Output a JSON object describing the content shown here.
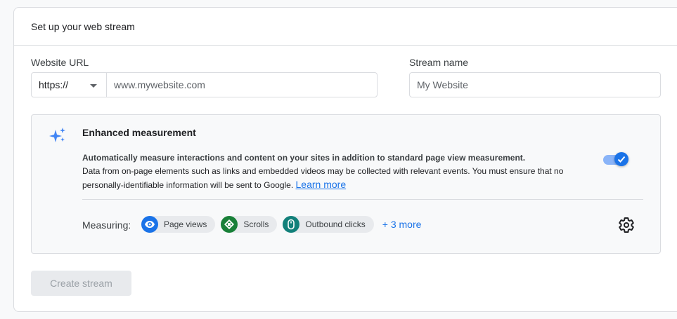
{
  "header": {
    "title": "Set up your web stream"
  },
  "website_url": {
    "label": "Website URL",
    "protocol": "https://",
    "placeholder": "www.mywebsite.com"
  },
  "stream_name": {
    "label": "Stream name",
    "placeholder": "My Website"
  },
  "enhanced": {
    "title": "Enhanced measurement",
    "desc_primary": "Automatically measure interactions and content on your sites in addition to standard page view measurement.",
    "desc_secondary": "Data from on-page elements such as links and embedded videos may be collected with relevant events. You must ensure that no personally-identifiable information will be sent to Google.",
    "learn_more": "Learn more",
    "toggle_on": true,
    "measuring_label": "Measuring:",
    "chips": [
      {
        "label": "Page views",
        "icon": "eye-icon",
        "color": "#1a73e8"
      },
      {
        "label": "Scrolls",
        "icon": "scroll-arrows-icon",
        "color": "#188038"
      },
      {
        "label": "Outbound clicks",
        "icon": "mouse-icon",
        "color": "#12807a"
      }
    ],
    "more": "+ 3 more"
  },
  "actions": {
    "create_label": "Create stream"
  }
}
